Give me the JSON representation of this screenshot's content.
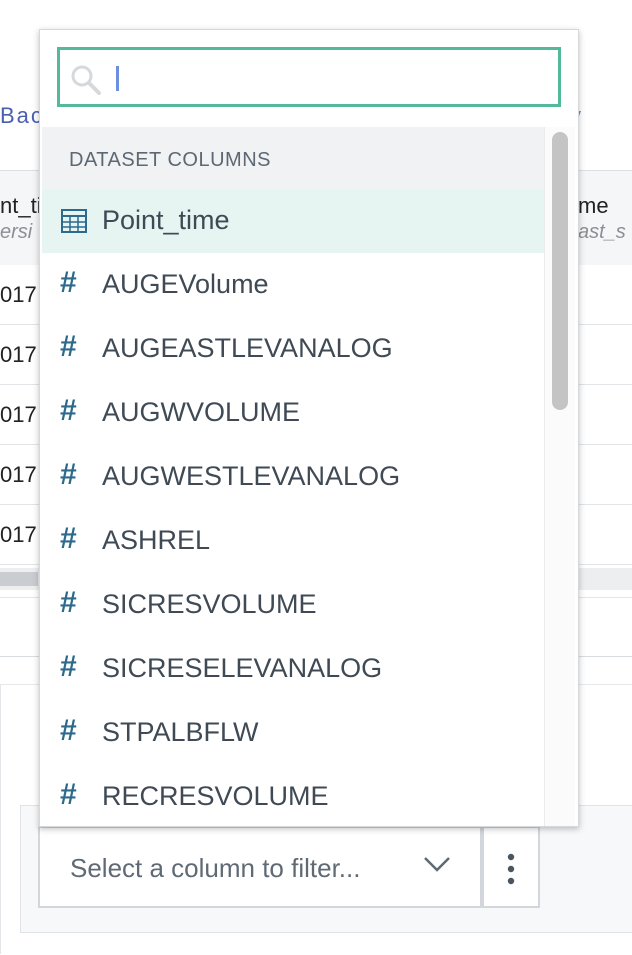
{
  "background": {
    "back_link": "Bac",
    "right_link": "y",
    "left_column": {
      "name": "nt_ti",
      "subtitle": "ersi"
    },
    "right_column": {
      "name": "me",
      "subtitle": "ast_s"
    },
    "rows": [
      "017",
      "017",
      "017",
      "017",
      "017"
    ]
  },
  "filter": {
    "placeholder": "Select a column to filter..."
  },
  "dropdown": {
    "search": {
      "value": "",
      "placeholder": ""
    },
    "section_title": "DATASET COLUMNS",
    "items": [
      {
        "label": "Point_time",
        "icon": "calendar-icon",
        "type_symbol": "",
        "selected": true
      },
      {
        "label": "AUGEVolume",
        "icon": "hash-icon",
        "type_symbol": "#",
        "selected": false
      },
      {
        "label": "AUGEASTLEVANALOG",
        "icon": "hash-icon",
        "type_symbol": "#",
        "selected": false
      },
      {
        "label": "AUGWVOLUME",
        "icon": "hash-icon",
        "type_symbol": "#",
        "selected": false
      },
      {
        "label": "AUGWESTLEVANALOG",
        "icon": "hash-icon",
        "type_symbol": "#",
        "selected": false
      },
      {
        "label": "ASHREL",
        "icon": "hash-icon",
        "type_symbol": "#",
        "selected": false
      },
      {
        "label": "SICRESVOLUME",
        "icon": "hash-icon",
        "type_symbol": "#",
        "selected": false
      },
      {
        "label": "SICRESELEVANALOG",
        "icon": "hash-icon",
        "type_symbol": "#",
        "selected": false
      },
      {
        "label": "STPALBFLW",
        "icon": "hash-icon",
        "type_symbol": "#",
        "selected": false
      },
      {
        "label": "RECRESVOLUME",
        "icon": "hash-icon",
        "type_symbol": "#",
        "selected": false
      }
    ]
  },
  "colors": {
    "accent_border": "#53b99a",
    "selected_bg": "#e6f5f2",
    "type_icon": "#2d6a8e"
  }
}
